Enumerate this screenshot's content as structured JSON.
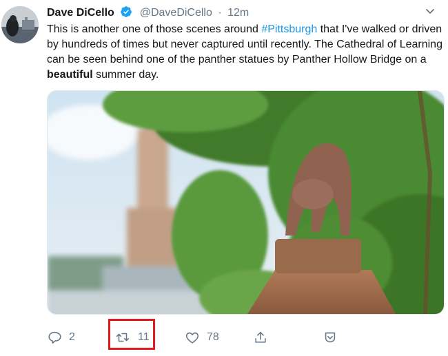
{
  "tweet": {
    "author_name": "Dave DiCello",
    "author_handle": "@DaveDiCello",
    "separator": "·",
    "timestamp": "12m",
    "text_part1": "This is another one of those scenes around ",
    "hashtag": "#Pittsburgh",
    "text_part2": " that I've walked or driven by hundreds of times but never captured until recently. The Cathedral of Learning can be seen behind one of the panther statues by Panther Hollow Bridge on a ",
    "bold_word": "beautiful",
    "text_part3": " summer day."
  },
  "actions": {
    "reply_count": "2",
    "retweet_count": "11",
    "like_count": "78"
  },
  "colors": {
    "link": "#1b95e0",
    "muted": "#657786",
    "verified": "#1da1f2",
    "highlight_box": "#e0191a"
  },
  "icons": [
    "verified-badge-icon",
    "chevron-down-icon",
    "reply-icon",
    "retweet-icon",
    "like-icon",
    "share-icon",
    "tweet-analytics-icon"
  ]
}
